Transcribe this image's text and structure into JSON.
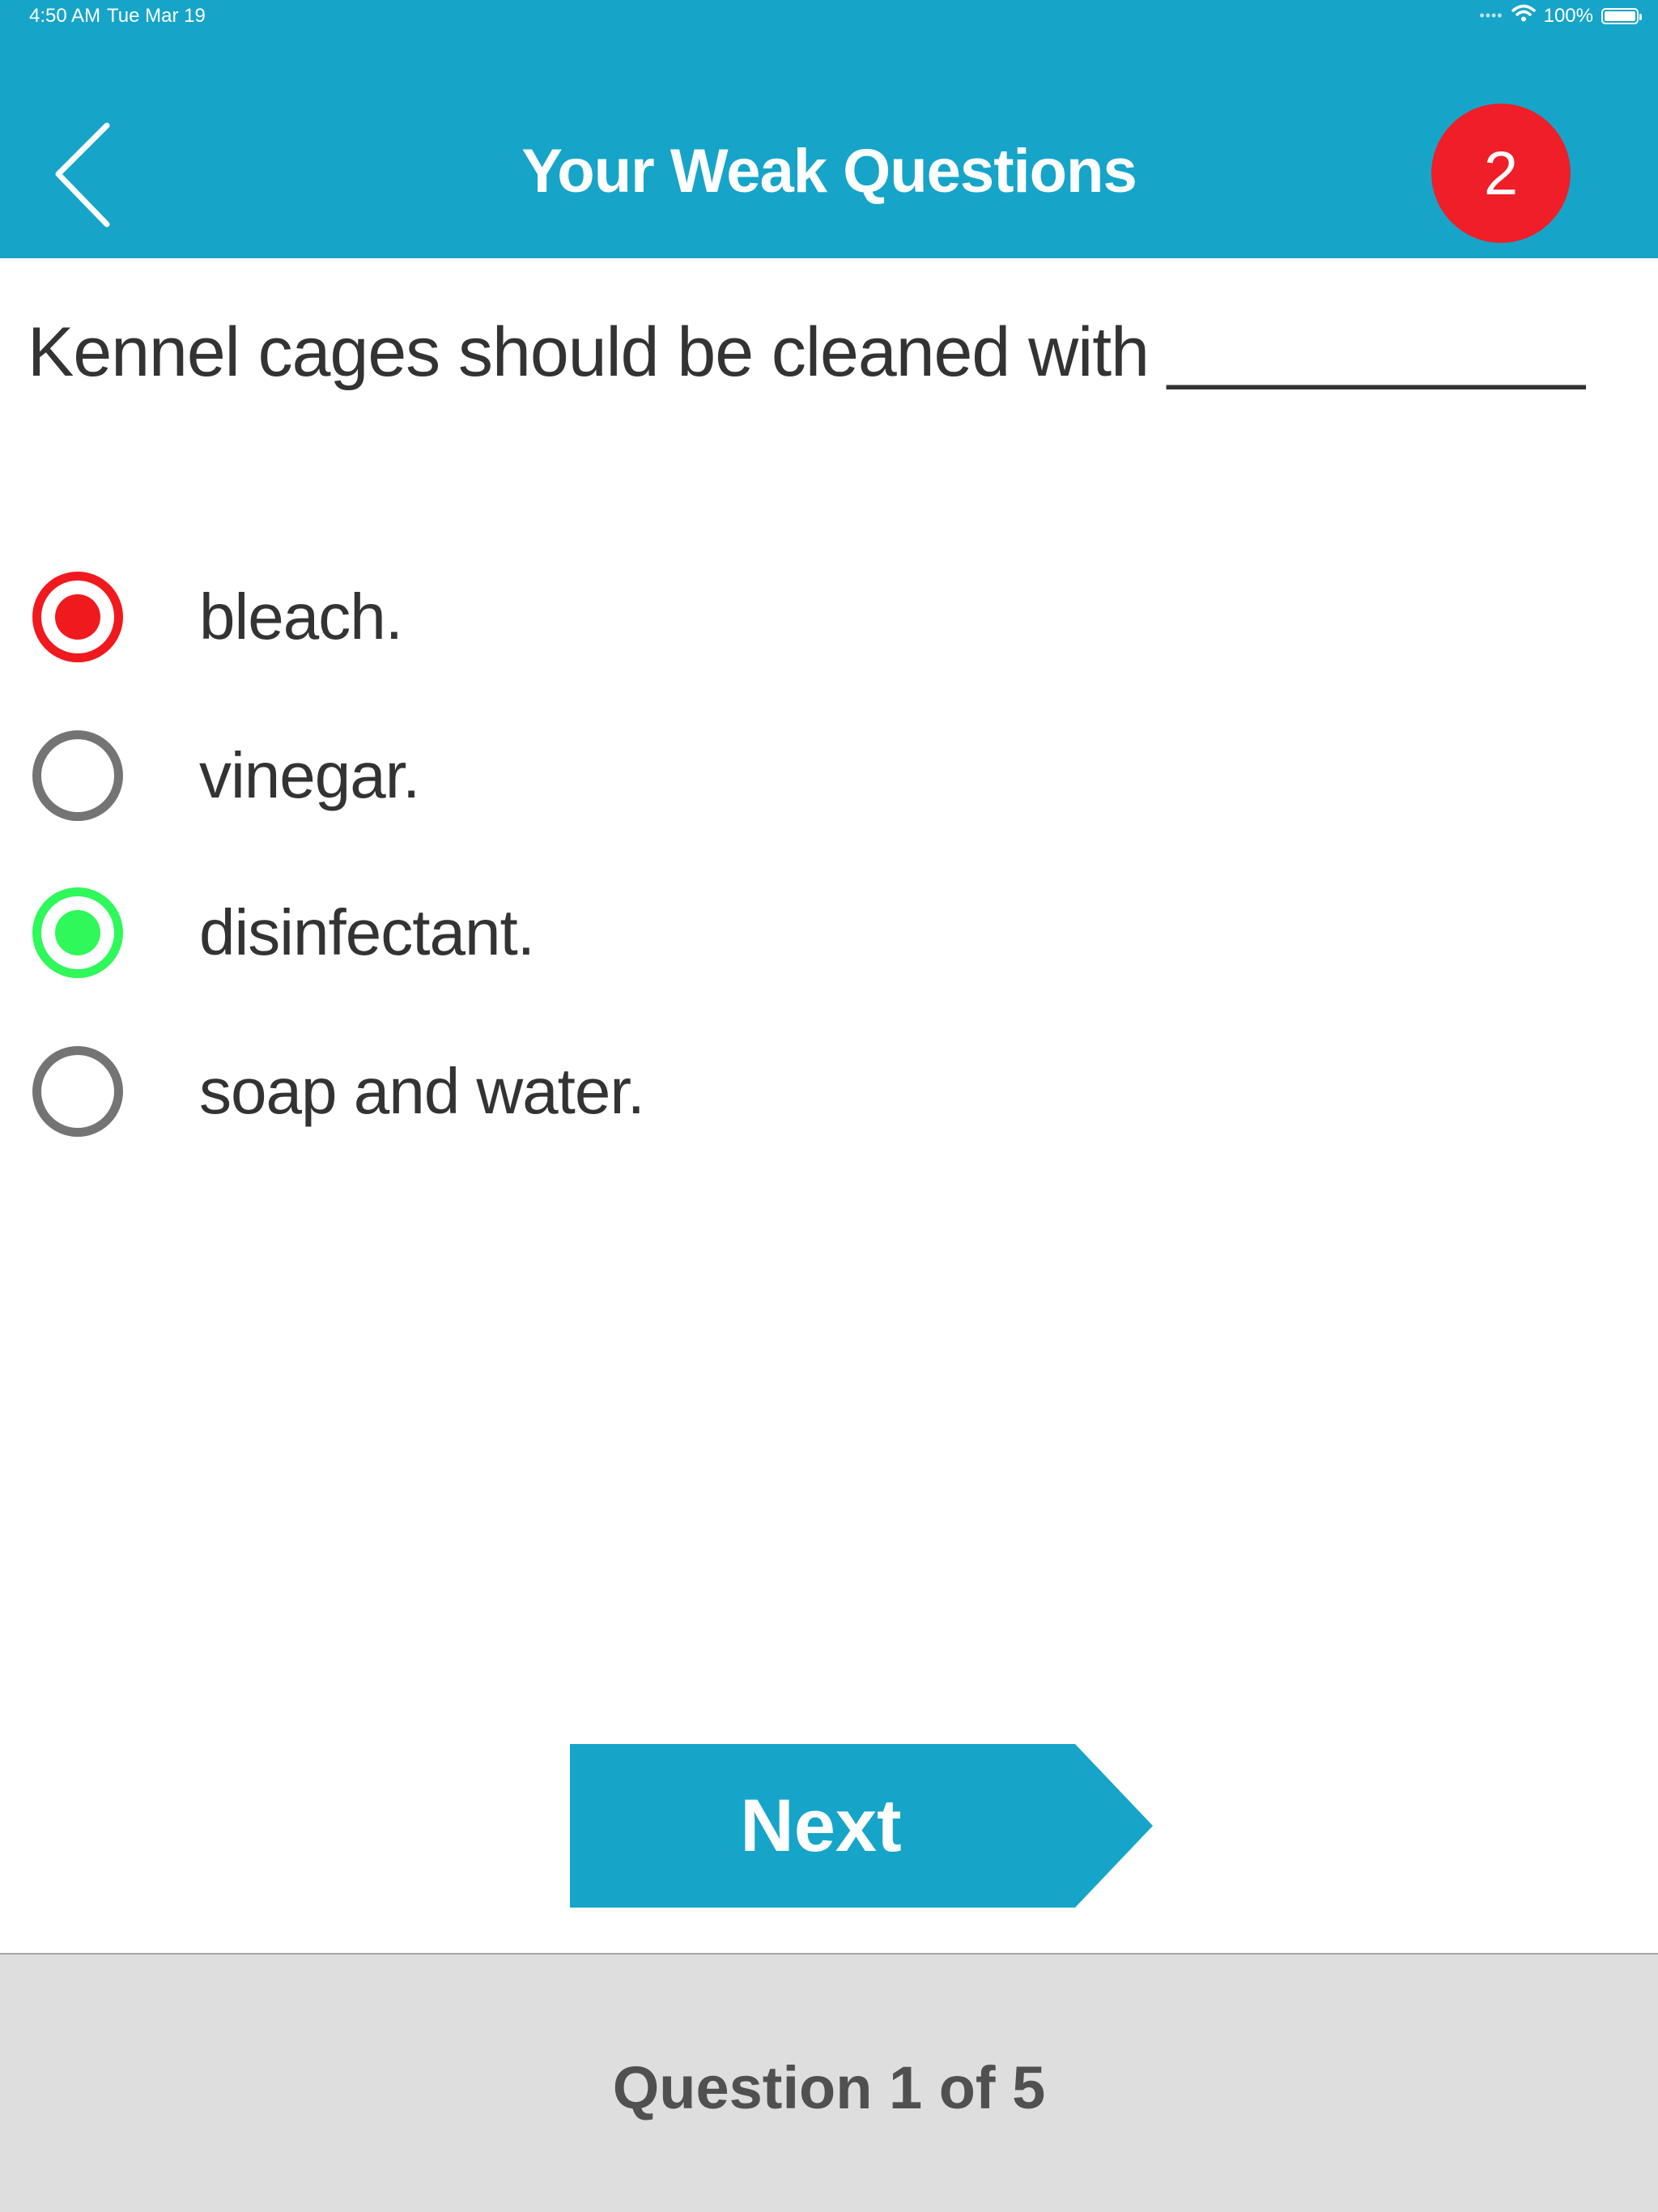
{
  "status_bar": {
    "time": "4:50 AM",
    "date": "Tue Mar 19",
    "signal_icon": "cellular-dots-icon",
    "wifi_icon": "wifi-icon",
    "battery": "100%",
    "battery_icon": "battery-full-icon"
  },
  "header": {
    "title": "Your Weak Questions",
    "back_icon": "chevron-left-icon",
    "badge_count": "2",
    "background_color": "#16a5c9",
    "badge_color": "#ef1e28"
  },
  "question": {
    "text": "Kennel cages should be cleaned with ___________"
  },
  "answers": [
    {
      "label": "bleach.",
      "state": "selected-wrong"
    },
    {
      "label": "vinegar.",
      "state": "unselected"
    },
    {
      "label": "disinfectant.",
      "state": "correct"
    },
    {
      "label": "soap and water.",
      "state": "unselected"
    }
  ],
  "colors": {
    "wrong": "#f0191e",
    "correct": "#2ff85a",
    "unselected": "#747474"
  },
  "next_button": {
    "label": "Next"
  },
  "footer": {
    "progress_label": "Question 1 of 5"
  }
}
